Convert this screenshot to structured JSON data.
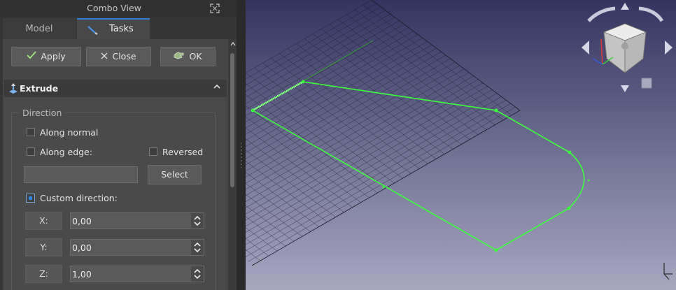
{
  "window": {
    "title": "Combo View"
  },
  "tabs": [
    {
      "label": "Model"
    },
    {
      "label": "Tasks"
    }
  ],
  "toolbar": {
    "apply_label": "Apply",
    "close_label": "Close",
    "ok_label": "OK"
  },
  "section": {
    "title": "Extrude"
  },
  "direction": {
    "title": "Direction",
    "along_normal": "Along normal",
    "along_edge": "Along edge:",
    "reversed": "Reversed",
    "edge_value": "",
    "select_label": "Select",
    "custom_direction": "Custom direction:",
    "x_label": "X:",
    "y_label": "Y:",
    "z_label": "Z:",
    "x_value": "0,00",
    "y_value": "0,00",
    "z_value": "1,00",
    "custom_selected": true
  },
  "colors": {
    "sketch": "#3cff3c",
    "accent": "#2f7fd8",
    "viewport_top": "#343460",
    "viewport_bottom": "#a7a7c1"
  },
  "icons": {
    "float": "float-toggle-icon",
    "tasks_tab": "sketcher-pen-icon",
    "apply": "checkmark-icon",
    "close": "close-x-icon",
    "ok": "ok-hand-icon",
    "section": "extrude-part-icon",
    "collapse": "chevron-up-icon",
    "navcube": "navigation-cube-icon",
    "axis": "axis-cross-icon"
  }
}
